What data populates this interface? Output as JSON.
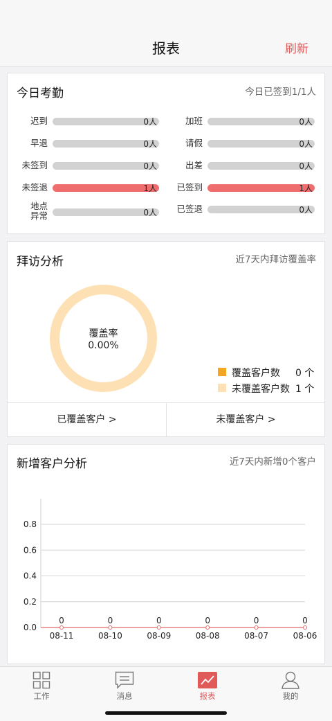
{
  "header": {
    "title": "报表",
    "refresh_label": "刷新"
  },
  "attendance": {
    "title": "今日考勤",
    "summary": "今日已签到1/1人",
    "left": [
      {
        "label": "迟到",
        "value": "0人",
        "fraction": 0,
        "highlight": false
      },
      {
        "label": "早退",
        "value": "0人",
        "fraction": 0,
        "highlight": false
      },
      {
        "label": "未签到",
        "value": "0人",
        "fraction": 0,
        "highlight": false
      },
      {
        "label": "未签退",
        "value": "1人",
        "fraction": 1,
        "highlight": true
      },
      {
        "label": "地点异常",
        "value": "0人",
        "fraction": 0,
        "highlight": false
      }
    ],
    "right": [
      {
        "label": "加班",
        "value": "0人",
        "fraction": 0,
        "highlight": false
      },
      {
        "label": "请假",
        "value": "0人",
        "fraction": 0,
        "highlight": false
      },
      {
        "label": "出差",
        "value": "0人",
        "fraction": 0,
        "highlight": false
      },
      {
        "label": "已签到",
        "value": "1人",
        "fraction": 1,
        "highlight": true
      },
      {
        "label": "已签退",
        "value": "0人",
        "fraction": 0,
        "highlight": false
      }
    ]
  },
  "visit": {
    "title": "拜访分析",
    "subtitle": "近7天内拜访覆盖率",
    "donut_label": "覆盖率",
    "donut_value": "0.00%",
    "legend": [
      {
        "label": "覆盖客户数",
        "count": "0 个",
        "color": "#f5a524"
      },
      {
        "label": "未覆盖客户数",
        "count": "1 个",
        "color": "#fde1b5"
      }
    ],
    "covered_button": "已覆盖客户 >",
    "uncovered_button": "未覆盖客户 >"
  },
  "new_customers": {
    "title": "新增客户分析",
    "subtitle": "近7天内新增0个客户"
  },
  "chart_data": {
    "type": "line",
    "x": [
      "08-11",
      "08-10",
      "08-09",
      "08-08",
      "08-07",
      "08-06"
    ],
    "series": [
      {
        "values": [
          0,
          0,
          0,
          0,
          0,
          0
        ]
      }
    ],
    "data_labels": [
      "0",
      "0",
      "0",
      "0",
      "0",
      "0"
    ],
    "yticks": [
      "0.0",
      "0.2",
      "0.4",
      "0.6",
      "0.8"
    ],
    "ylim": [
      0,
      0.8
    ],
    "grid": true,
    "line_color": "#e06a6a"
  },
  "tabbar": {
    "items": [
      {
        "label": "工作",
        "icon": "grid-icon",
        "active": false
      },
      {
        "label": "消息",
        "icon": "message-icon",
        "active": false
      },
      {
        "label": "报表",
        "icon": "report-chart-icon",
        "active": true
      },
      {
        "label": "我的",
        "icon": "person-icon",
        "active": false
      }
    ]
  }
}
